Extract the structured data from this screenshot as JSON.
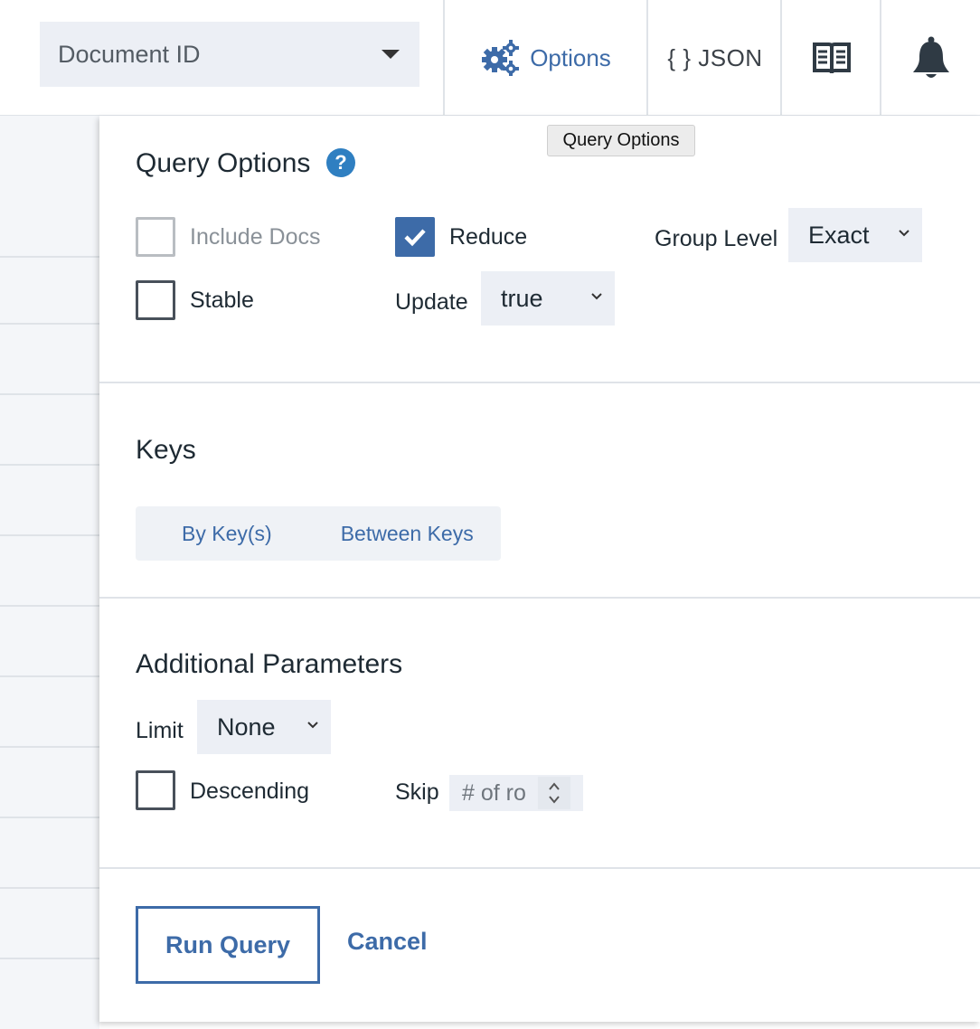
{
  "header": {
    "doc_select": {
      "value": "Document ID"
    },
    "options_label": "Options",
    "json_label": "{ } JSON",
    "icons": {
      "options": "gears-icon",
      "docs": "book-icon",
      "notifications": "bell-icon"
    }
  },
  "tooltip": {
    "text": "Query Options"
  },
  "query_options": {
    "title": "Query Options",
    "include_docs": {
      "label": "Include Docs",
      "checked": false,
      "disabled": true
    },
    "reduce": {
      "label": "Reduce",
      "checked": true
    },
    "stable": {
      "label": "Stable",
      "checked": false
    },
    "group_level": {
      "label": "Group Level",
      "value": "Exact"
    },
    "update": {
      "label": "Update",
      "value": "true"
    }
  },
  "keys": {
    "title": "Keys",
    "tabs": [
      "By Key(s)",
      "Between Keys"
    ]
  },
  "additional": {
    "title": "Additional Parameters",
    "limit": {
      "label": "Limit",
      "value": "None"
    },
    "descending": {
      "label": "Descending",
      "checked": false
    },
    "skip": {
      "label": "Skip",
      "placeholder": "# of ro"
    }
  },
  "actions": {
    "run": "Run Query",
    "cancel": "Cancel"
  },
  "colors": {
    "accent": "#3d6ba8",
    "select_bg": "#eceff5",
    "help": "#2f7fc1"
  }
}
